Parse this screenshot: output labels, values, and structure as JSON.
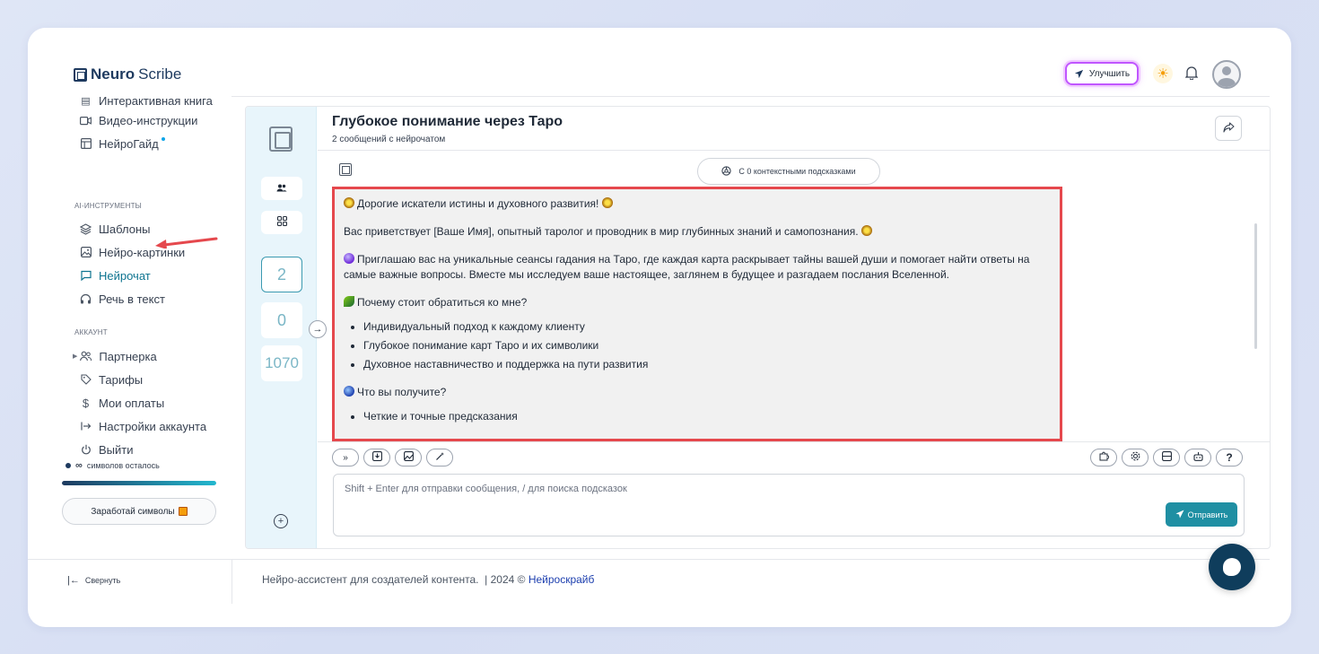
{
  "app": {
    "logo_bold": "Neuro",
    "logo_thin": "Scribe"
  },
  "header": {
    "upgrade_label": "Улучшить"
  },
  "sidebar": {
    "items_top": [
      {
        "label": "Интерактивная книга",
        "icon": "book-icon"
      },
      {
        "label": "Видео-инструкции",
        "icon": "video-icon"
      },
      {
        "label": "НейроГайд",
        "icon": "guide-icon"
      }
    ],
    "section_ai": "AI-ИНСТРУМЕНТЫ",
    "items_ai": [
      {
        "label": "Шаблоны",
        "icon": "layers-icon"
      },
      {
        "label": "Нейро-картинки",
        "icon": "image-icon"
      },
      {
        "label": "Нейрочат",
        "icon": "chat-icon"
      },
      {
        "label": "Речь в текст",
        "icon": "headphones-icon"
      }
    ],
    "section_account": "АККАУНТ",
    "items_account": [
      {
        "label": "Партнерка",
        "icon": "users-icon"
      },
      {
        "label": "Тарифы",
        "icon": "tag-icon"
      },
      {
        "label": "Мои оплаты",
        "icon": "dollar-icon"
      },
      {
        "label": "Настройки аккаунта",
        "icon": "login-icon"
      },
      {
        "label": "Выйти",
        "icon": "power-icon"
      }
    ],
    "chars_symbol": "∞",
    "chars_label": "символов осталось",
    "chars_progress": 1.0,
    "earn_label": "Заработай символы",
    "collapse_label": "Свернуть"
  },
  "rail": {
    "count_1": "2",
    "count_2": "0",
    "count_3": "1070"
  },
  "chat": {
    "title": "Глубокое понимание через Таро",
    "subtitle": "2 сообщений с нейрочатом",
    "context_pill": "С 0 контекстными подсказками",
    "message": {
      "p1": "Дорогие искатели истины и духовного развития!",
      "p2": "Вас приветствует [Ваше Имя], опытный таролог и проводник в мир глубинных знаний и самопознания.",
      "p3": "Приглашаю вас на уникальные сеансы гадания на Таро, где каждая карта раскрывает тайны вашей души и помогает найти ответы на самые важные вопросы. Вместе мы исследуем ваше настоящее, заглянем в будущее и разгадаем послания Вселенной.",
      "h1": "Почему стоит обратиться ко мне?",
      "list1": [
        "Индивидуальный подход к каждому клиенту",
        "Глубокое понимание карт Таро и их символики",
        "Духовное наставничество и поддержка на пути развития"
      ],
      "h2": "Что вы получите?",
      "list2": [
        "Четкие и точные предсказания"
      ]
    },
    "input_placeholder": "Shift + Enter для отправки сообщения, / для поиска подсказок",
    "send_label": "Отправить",
    "help_label": "?"
  },
  "footer": {
    "text": "Нейро-ассистент для создателей контента.  | 2024 © ",
    "link": "Нейроскрайб"
  }
}
